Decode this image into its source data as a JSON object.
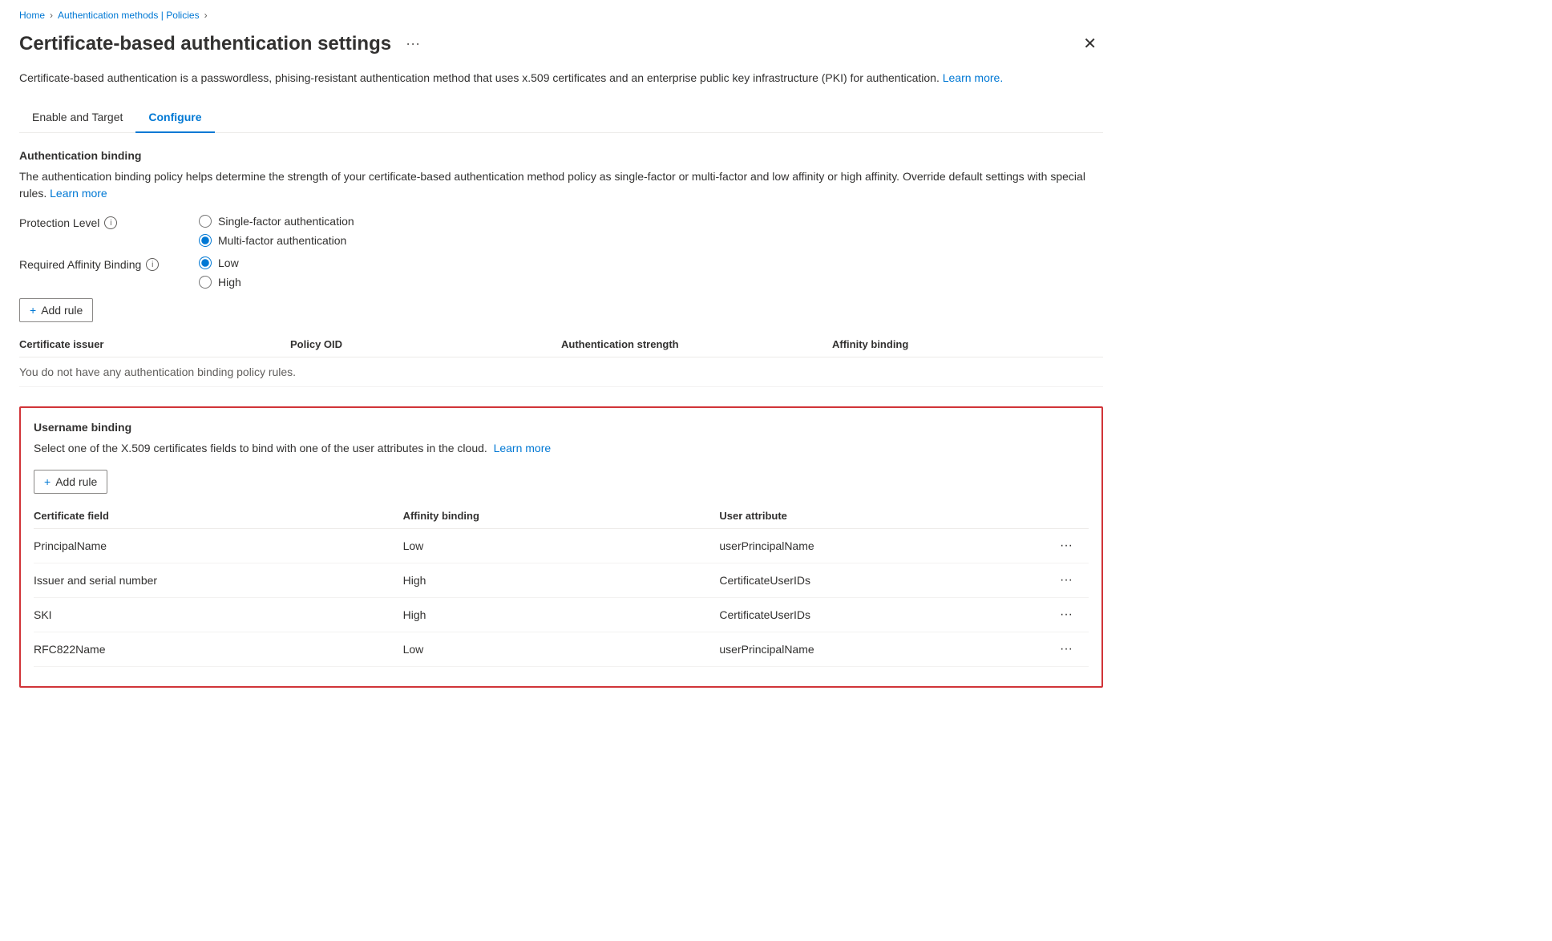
{
  "breadcrumb": {
    "home": "Home",
    "policies": "Authentication methods | Policies",
    "separator": "›"
  },
  "page": {
    "title": "Certificate-based authentication settings",
    "more_options_label": "···",
    "close_label": "✕",
    "description": "Certificate-based authentication is a passwordless, phising-resistant authentication method that uses x.509 certificates and an enterprise public key infrastructure (PKI) for authentication.",
    "learn_more_link": "Learn more."
  },
  "tabs": [
    {
      "id": "enable-target",
      "label": "Enable and Target",
      "active": false
    },
    {
      "id": "configure",
      "label": "Configure",
      "active": true
    }
  ],
  "auth_binding": {
    "section_title": "Authentication binding",
    "description": "The authentication binding policy helps determine the strength of your certificate-based authentication method policy as single-factor or multi-factor and low affinity or high affinity. Override default settings with special rules.",
    "learn_more_link": "Learn more",
    "protection_level": {
      "label": "Protection Level",
      "options": [
        {
          "id": "single-factor",
          "label": "Single-factor authentication",
          "checked": false
        },
        {
          "id": "multi-factor",
          "label": "Multi-factor authentication",
          "checked": true
        }
      ]
    },
    "affinity_binding": {
      "label": "Required Affinity Binding",
      "options": [
        {
          "id": "low",
          "label": "Low",
          "checked": true
        },
        {
          "id": "high",
          "label": "High",
          "checked": false
        }
      ]
    },
    "add_rule_label": "+ Add rule",
    "table_headers": {
      "certificate_issuer": "Certificate issuer",
      "policy_oid": "Policy OID",
      "auth_strength": "Authentication strength",
      "affinity_binding": "Affinity binding"
    },
    "no_data_text": "You do not have any authentication binding policy rules."
  },
  "username_binding": {
    "section_title": "Username binding",
    "description": "Select one of the X.509 certificates fields to bind with one of the user attributes in the cloud.",
    "learn_more_link": "Learn more",
    "add_rule_label": "+ Add rule",
    "table_headers": {
      "certificate_field": "Certificate field",
      "affinity_binding": "Affinity binding",
      "user_attribute": "User attribute"
    },
    "rows": [
      {
        "certificate_field": "PrincipalName",
        "affinity_binding": "Low",
        "user_attribute": "userPrincipalName"
      },
      {
        "certificate_field": "Issuer and serial number",
        "affinity_binding": "High",
        "user_attribute": "CertificateUserIDs"
      },
      {
        "certificate_field": "SKI",
        "affinity_binding": "High",
        "user_attribute": "CertificateUserIDs"
      },
      {
        "certificate_field": "RFC822Name",
        "affinity_binding": "Low",
        "user_attribute": "userPrincipalName"
      }
    ]
  }
}
